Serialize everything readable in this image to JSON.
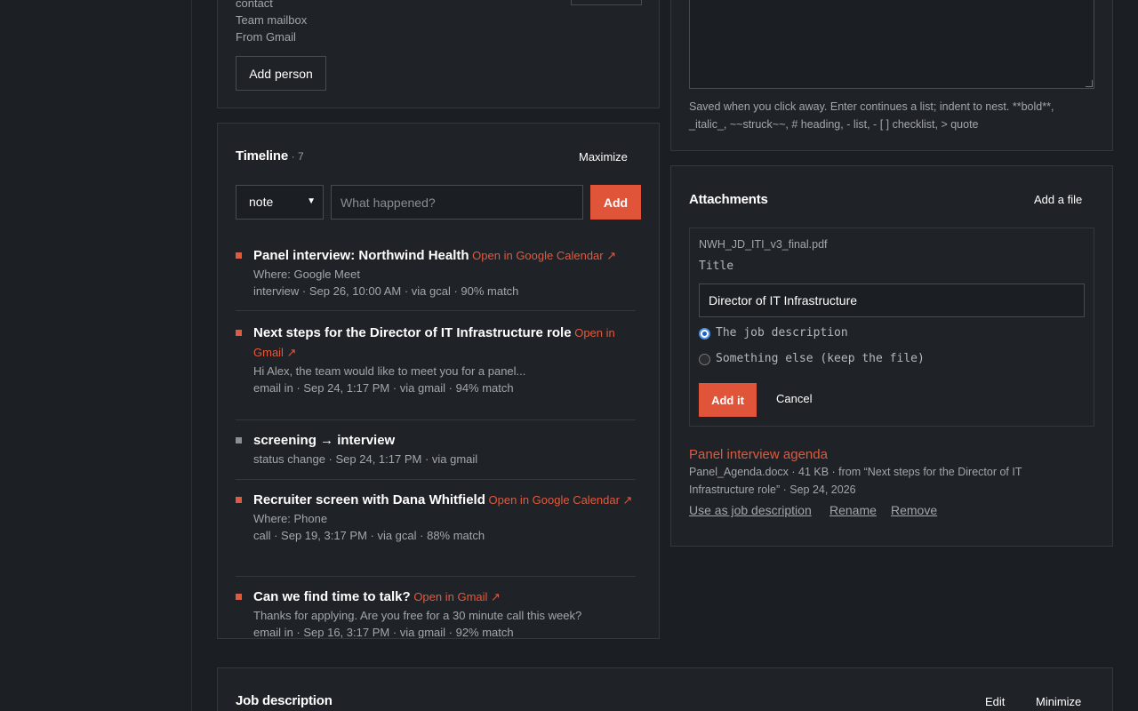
{
  "people": {
    "lines": [
      "contact",
      "Team mailbox",
      "From Gmail"
    ],
    "add_person": "Add person"
  },
  "notes": {
    "help": "Saved when you click away. Enter continues a list; indent to nest. **bold**, _italic_, ~~struck~~, # heading, - list, - [ ] checklist, > quote"
  },
  "timeline": {
    "title": "Timeline",
    "count": "· 7",
    "maximize": "Maximize",
    "type_select": "note",
    "what_placeholder": "What happened?",
    "add": "Add",
    "events": [
      {
        "title": "Panel interview: Northwind Health",
        "link": "Open in Google Calendar ↗",
        "lines": [
          "Where: Google Meet",
          "interview · Sep 26, 10:00 AM · via gcal · 90% match"
        ],
        "marker": "accent"
      },
      {
        "title": "Next steps for the Director of IT Infrastructure role",
        "link": "Open in Gmail ↗",
        "lines": [
          "Hi Alex, the team would like to meet you for a panel...",
          "email in · Sep 24, 1:17 PM · via gmail · 94% match"
        ],
        "marker": "accent"
      },
      {
        "title": "screening → interview",
        "link": "",
        "lines": [
          "status change · Sep 24, 1:17 PM · via gmail"
        ],
        "marker": "gray"
      },
      {
        "title": "Recruiter screen with Dana Whitfield",
        "link": "Open in Google Calendar ↗",
        "lines": [
          "Where: Phone",
          "call · Sep 19, 3:17 PM · via gcal · 88% match"
        ],
        "marker": "accent"
      },
      {
        "title": "Can we find time to talk?",
        "link": "Open in Gmail ↗",
        "lines": [
          "Thanks for applying. Are you free for a 30 minute call this week?",
          "email in · Sep 16, 3:17 PM · via gmail · 92% match"
        ],
        "marker": "accent"
      }
    ]
  },
  "attachments": {
    "title": "Attachments",
    "add_file": "Add a file",
    "form": {
      "filename": "NWH_JD_ITI_v3_final.pdf",
      "title_label": "Title",
      "title_value": "Director of IT Infrastructure",
      "option_jd": "The job description",
      "option_else": "Something else (keep the file)",
      "add_it": "Add it",
      "cancel": "Cancel"
    },
    "item": {
      "name": "Panel interview agenda",
      "meta": "Panel_Agenda.docx · 41 KB · from “Next steps for the Director of IT Infrastructure role” · Sep 24, 2026",
      "use_as_jd": "Use as job description",
      "rename": "Rename",
      "remove": "Remove"
    }
  },
  "job_description": {
    "title": "Job description",
    "edit": "Edit",
    "minimize": "Minimize"
  },
  "colors": {
    "accent": "#e05a3f",
    "background": "#1b1e22",
    "panel": "#1f2226"
  }
}
